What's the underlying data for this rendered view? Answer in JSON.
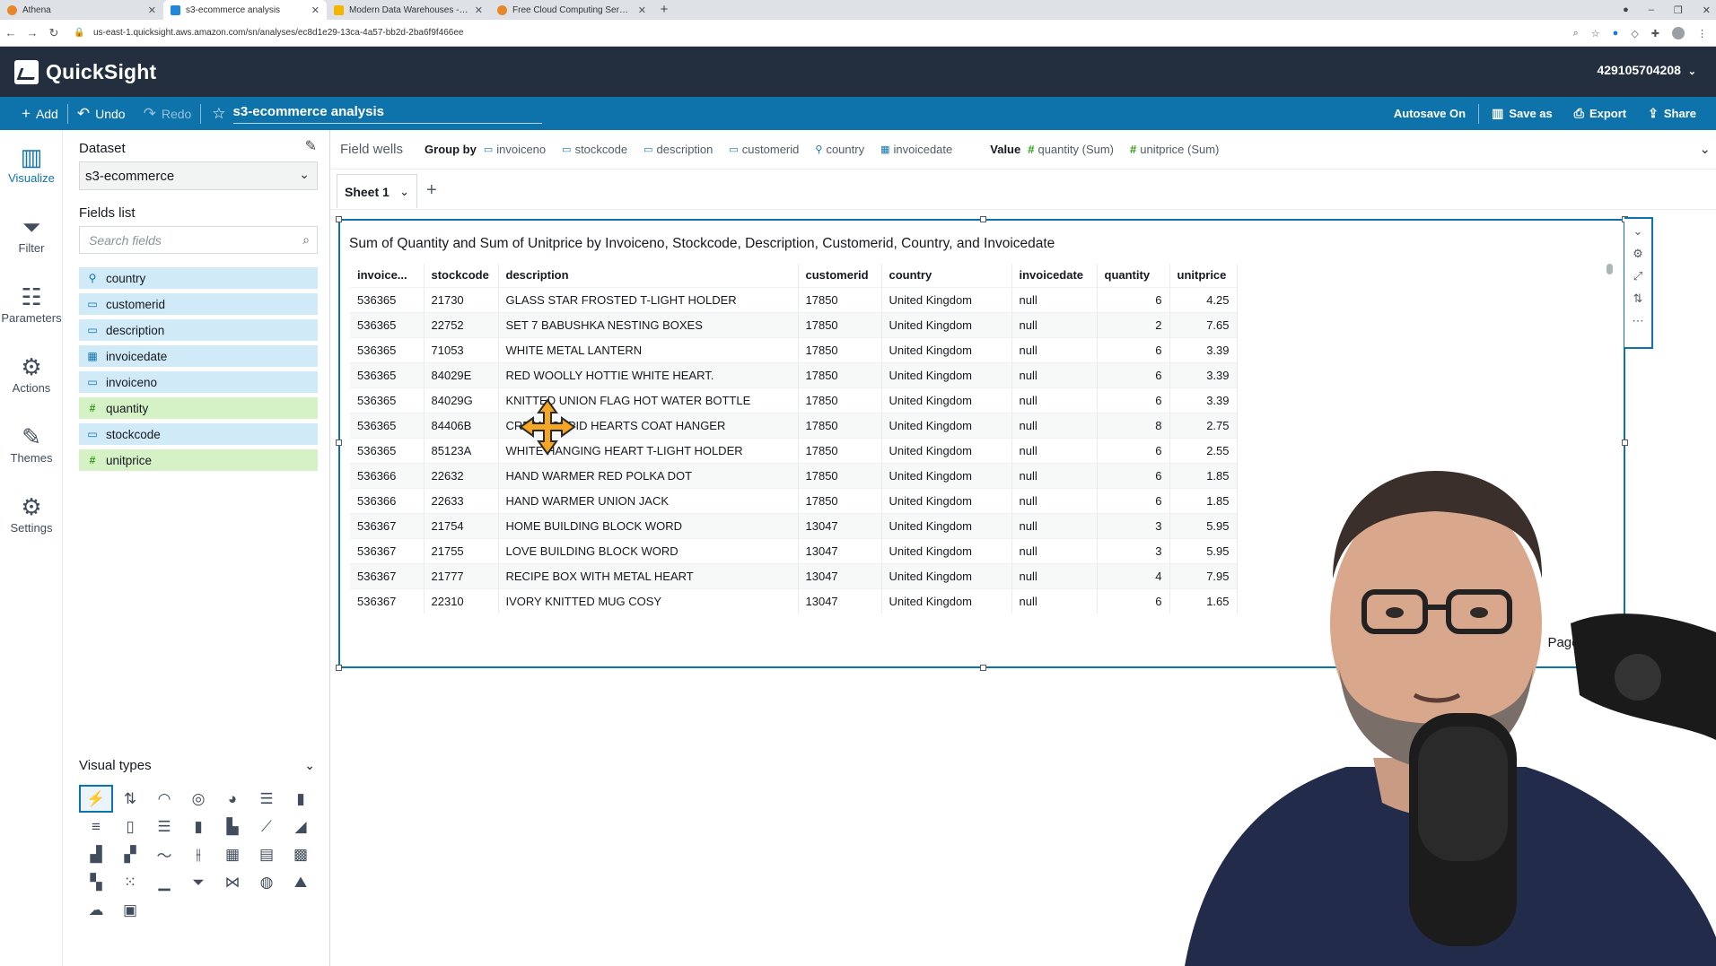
{
  "browser": {
    "tabs": [
      {
        "title": "Athena",
        "color": "#e8872a"
      },
      {
        "title": "s3-ecommerce analysis",
        "color": "#1f88d8"
      },
      {
        "title": "Modern Data Warehouses - Goo",
        "color": "#f4b400"
      },
      {
        "title": "Free Cloud Computing Services",
        "color": "#e8872a"
      }
    ],
    "url": "us-east-1.quicksight.aws.amazon.com/sn/analyses/ec8d1e29-13ca-4a57-bb2d-2ba6f9f466ee"
  },
  "header": {
    "brand": "QuickSight",
    "account": "429105704208"
  },
  "toolbar": {
    "add": "Add",
    "undo": "Undo",
    "redo": "Redo",
    "title": "s3-ecommerce analysis",
    "autosave": "Autosave On",
    "save_as": "Save as",
    "export": "Export",
    "share": "Share"
  },
  "rail": {
    "visualize": "Visualize",
    "filter": "Filter",
    "parameters": "Parameters",
    "actions": "Actions",
    "themes": "Themes",
    "settings": "Settings"
  },
  "dataset": {
    "label": "Dataset",
    "selected": "s3-ecommerce",
    "fields_label": "Fields list",
    "search_placeholder": "Search fields",
    "fields": [
      {
        "name": "country",
        "kind": "dimension",
        "icon": "location-icon"
      },
      {
        "name": "customerid",
        "kind": "dimension",
        "icon": "text-icon"
      },
      {
        "name": "description",
        "kind": "dimension",
        "icon": "text-icon"
      },
      {
        "name": "invoicedate",
        "kind": "dimension",
        "icon": "calendar-icon"
      },
      {
        "name": "invoiceno",
        "kind": "dimension",
        "icon": "text-icon"
      },
      {
        "name": "quantity",
        "kind": "measure",
        "icon": "hash-icon"
      },
      {
        "name": "stockcode",
        "kind": "dimension",
        "icon": "text-icon"
      },
      {
        "name": "unitprice",
        "kind": "measure",
        "icon": "hash-icon"
      }
    ],
    "visual_types_label": "Visual types"
  },
  "wells": {
    "label": "Field wells",
    "group_by_label": "Group by",
    "group_by": [
      "invoiceno",
      "stockcode",
      "description",
      "customerid",
      "country",
      "invoicedate"
    ],
    "value_label": "Value",
    "values": [
      "quantity (Sum)",
      "unitprice (Sum)"
    ]
  },
  "sheet": {
    "name": "Sheet 1"
  },
  "visual": {
    "title": "Sum of Quantity and Sum of Unitprice by Invoiceno, Stockcode, Description, Customerid, Country, and Invoicedate",
    "columns": [
      "invoice...",
      "stockcode",
      "description",
      "customerid",
      "country",
      "invoicedate",
      "quantity",
      "unitprice"
    ],
    "rows": [
      [
        "536365",
        "21730",
        "GLASS STAR FROSTED T-LIGHT HOLDER",
        "17850",
        "United Kingdom",
        "null",
        "6",
        "4.25"
      ],
      [
        "536365",
        "22752",
        "SET 7 BABUSHKA NESTING BOXES",
        "17850",
        "United Kingdom",
        "null",
        "2",
        "7.65"
      ],
      [
        "536365",
        "71053",
        "WHITE METAL LANTERN",
        "17850",
        "United Kingdom",
        "null",
        "6",
        "3.39"
      ],
      [
        "536365",
        "84029E",
        "RED WOOLLY HOTTIE WHITE HEART.",
        "17850",
        "United Kingdom",
        "null",
        "6",
        "3.39"
      ],
      [
        "536365",
        "84029G",
        "KNITTED UNION FLAG HOT WATER BOTTLE",
        "17850",
        "United Kingdom",
        "null",
        "6",
        "3.39"
      ],
      [
        "536365",
        "84406B",
        "CREAM CUPID HEARTS COAT HANGER",
        "17850",
        "United Kingdom",
        "null",
        "8",
        "2.75"
      ],
      [
        "536365",
        "85123A",
        "WHITE HANGING HEART T-LIGHT HOLDER",
        "17850",
        "United Kingdom",
        "null",
        "6",
        "2.55"
      ],
      [
        "536366",
        "22632",
        "HAND WARMER RED POLKA DOT",
        "17850",
        "United Kingdom",
        "null",
        "6",
        "1.85"
      ],
      [
        "536366",
        "22633",
        "HAND WARMER UNION JACK",
        "17850",
        "United Kingdom",
        "null",
        "6",
        "1.85"
      ],
      [
        "536367",
        "21754",
        "HOME BUILDING BLOCK WORD",
        "13047",
        "United Kingdom",
        "null",
        "3",
        "5.95"
      ],
      [
        "536367",
        "21755",
        "LOVE BUILDING BLOCK WORD",
        "13047",
        "United Kingdom",
        "null",
        "3",
        "5.95"
      ],
      [
        "536367",
        "21777",
        "RECIPE BOX WITH METAL HEART",
        "13047",
        "United Kingdom",
        "null",
        "4",
        "7.95"
      ],
      [
        "536367",
        "22310",
        "IVORY KNITTED MUG COSY",
        "13047",
        "United Kingdom",
        "null",
        "6",
        "1.65"
      ]
    ],
    "page_label": "Page 1"
  },
  "colors": {
    "header_bg": "#232f3e",
    "toolbar_bg": "#0f73ab",
    "dimension_bg": "#d1eaf8",
    "measure_bg": "#d5f1c6",
    "accent": "#0f73ab"
  }
}
